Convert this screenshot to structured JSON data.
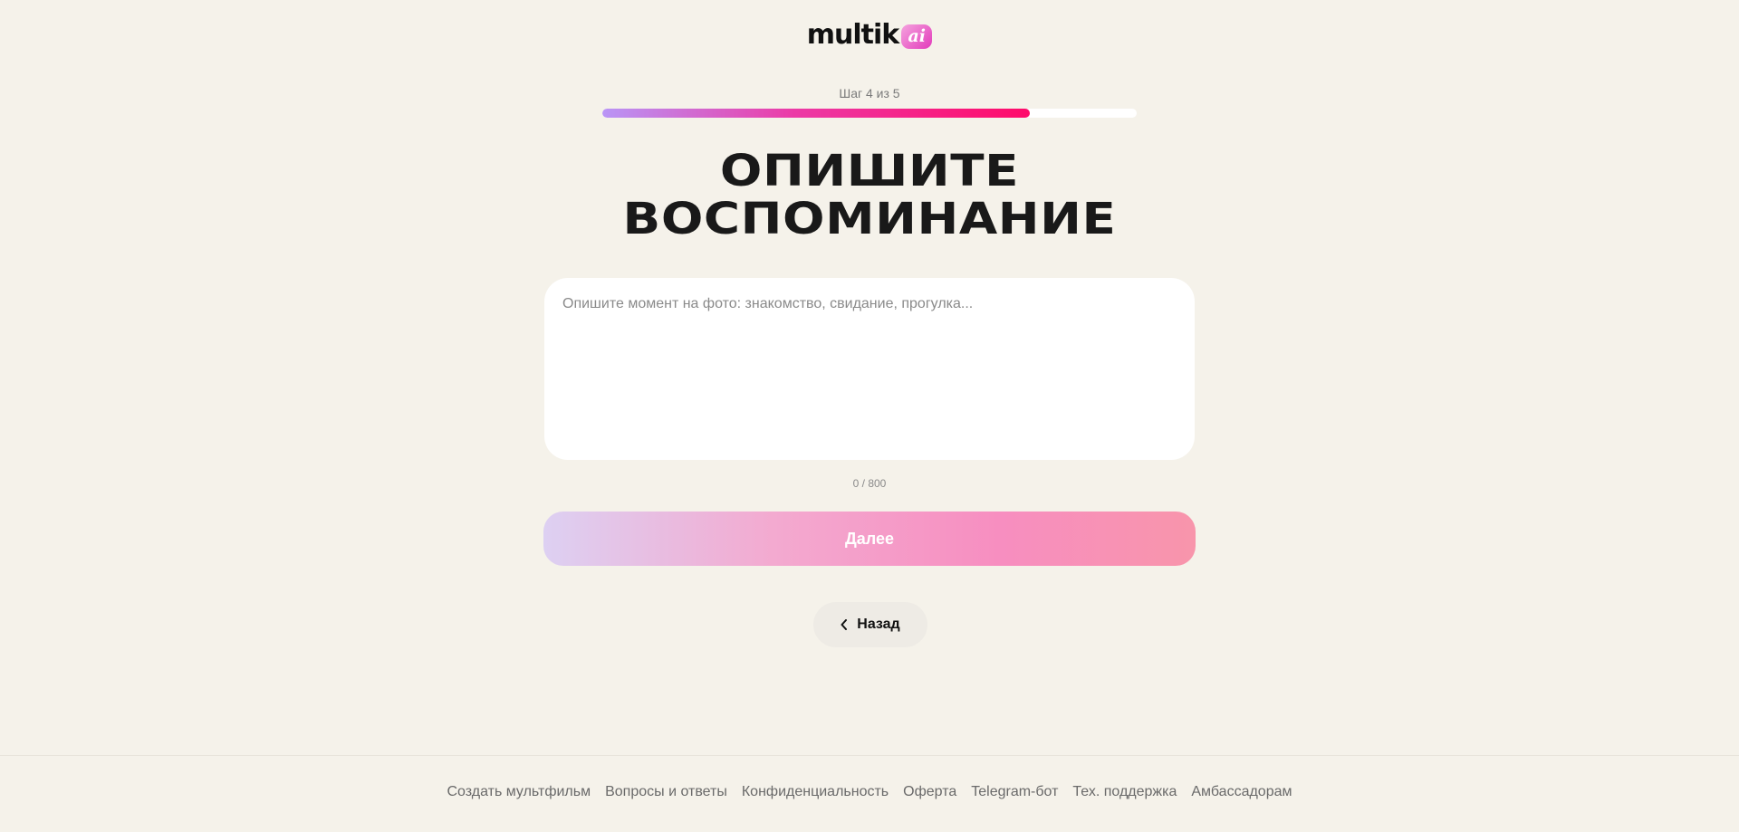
{
  "header": {
    "logo_text": "multik",
    "logo_badge": "ai"
  },
  "progress": {
    "step_label": "Шаг 4 из 5",
    "fraction": 0.8
  },
  "main": {
    "title_line1": "ОПИШИТЕ",
    "title_line2": "ВОСПОМИНАНИЕ",
    "textarea_placeholder": "Опишите момент на фото: знакомство, свидание, прогулка...",
    "textarea_value": "",
    "counter": "0 / 800",
    "next_label": "Далее",
    "back_label": "Назад"
  },
  "footer": {
    "links": [
      "Создать мультфильм",
      "Вопросы и ответы",
      "Конфиденциальность",
      "Оферта",
      "Telegram-бот",
      "Тех. поддержка",
      "Амбассадорам"
    ]
  },
  "colors": {
    "background": "#f5f2ea",
    "progress_start": "#b995f6",
    "progress_end": "#ff0b6a",
    "brand_pink": "#e23bbb"
  },
  "icons": {
    "back": "chevron-left-icon"
  }
}
